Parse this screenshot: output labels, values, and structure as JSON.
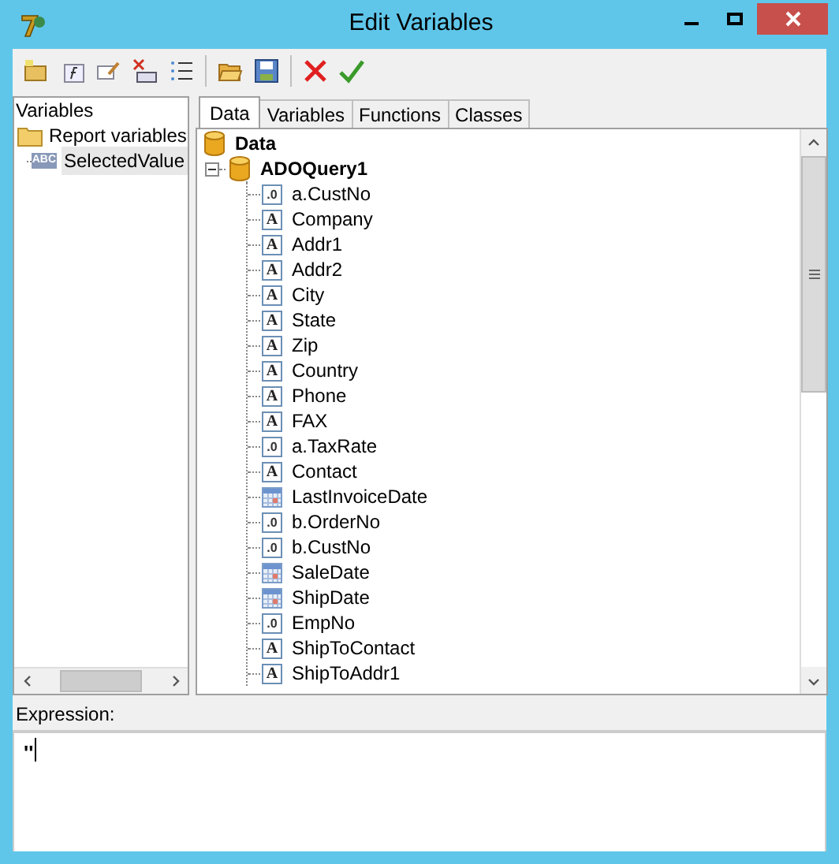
{
  "window": {
    "title": "Edit Variables"
  },
  "variables_panel": {
    "title": "Variables",
    "items": [
      {
        "label": "Report variables",
        "kind": "folder",
        "children": [
          {
            "label": "SelectedValue",
            "kind": "variable",
            "icon_text": "ABC",
            "selected": true
          }
        ]
      }
    ]
  },
  "tabs": [
    {
      "label": "Data",
      "selected": true
    },
    {
      "label": "Variables",
      "selected": false
    },
    {
      "label": "Functions",
      "selected": false
    },
    {
      "label": "Classes",
      "selected": false
    }
  ],
  "tree": {
    "root": "Data",
    "dataset": {
      "label": "ADOQuery1",
      "expanded": true,
      "fields": [
        {
          "label": "a.CustNo",
          "kind": "number",
          "icon_text": ".0"
        },
        {
          "label": "Company",
          "kind": "string",
          "icon_text": "A"
        },
        {
          "label": "Addr1",
          "kind": "string",
          "icon_text": "A"
        },
        {
          "label": "Addr2",
          "kind": "string",
          "icon_text": "A"
        },
        {
          "label": "City",
          "kind": "string",
          "icon_text": "A"
        },
        {
          "label": "State",
          "kind": "string",
          "icon_text": "A"
        },
        {
          "label": "Zip",
          "kind": "string",
          "icon_text": "A"
        },
        {
          "label": "Country",
          "kind": "string",
          "icon_text": "A"
        },
        {
          "label": "Phone",
          "kind": "string",
          "icon_text": "A"
        },
        {
          "label": "FAX",
          "kind": "string",
          "icon_text": "A"
        },
        {
          "label": "a.TaxRate",
          "kind": "number",
          "icon_text": ".0"
        },
        {
          "label": "Contact",
          "kind": "string",
          "icon_text": "A"
        },
        {
          "label": "LastInvoiceDate",
          "kind": "date"
        },
        {
          "label": "b.OrderNo",
          "kind": "number",
          "icon_text": ".0"
        },
        {
          "label": "b.CustNo",
          "kind": "number",
          "icon_text": ".0"
        },
        {
          "label": "SaleDate",
          "kind": "date"
        },
        {
          "label": "ShipDate",
          "kind": "date"
        },
        {
          "label": "EmpNo",
          "kind": "number",
          "icon_text": ".0"
        },
        {
          "label": "ShipToContact",
          "kind": "string",
          "icon_text": "A"
        },
        {
          "label": "ShipToAddr1",
          "kind": "string",
          "icon_text": "A"
        }
      ]
    }
  },
  "expression": {
    "label": "Expression:",
    "value": "''"
  }
}
